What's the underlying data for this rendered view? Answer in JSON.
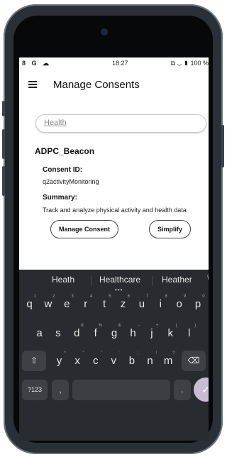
{
  "status": {
    "left_icons": "8 G ☁",
    "time": "18:27",
    "right": "⧉ ◡ ▮ 100 %"
  },
  "appbar": {
    "title": "Manage Consents"
  },
  "search": {
    "value": "Health"
  },
  "consent": {
    "name": "ADPC_Beacon",
    "id_label": "Consent ID:",
    "id_value": "q2activityMonitoring",
    "summary_label": "Summary:",
    "summary_value": "Track and analyze physical activity and health data",
    "manage_label": "Manage Consent",
    "simplify_label": "Simplify"
  },
  "keyboard": {
    "suggestions": [
      "Heath",
      "Healthcare",
      "Heather"
    ],
    "row1": [
      {
        "k": "q",
        "h": "1"
      },
      {
        "k": "w",
        "h": "2"
      },
      {
        "k": "e",
        "h": "3"
      },
      {
        "k": "r",
        "h": "4"
      },
      {
        "k": "t",
        "h": "5"
      },
      {
        "k": "z",
        "h": "6"
      },
      {
        "k": "u",
        "h": "7"
      },
      {
        "k": "i",
        "h": "8"
      },
      {
        "k": "o",
        "h": "9"
      },
      {
        "k": "p",
        "h": "0"
      }
    ],
    "row2": [
      {
        "k": "a",
        "h": ""
      },
      {
        "k": "s",
        "h": ""
      },
      {
        "k": "d",
        "h": "€"
      },
      {
        "k": "f",
        "h": "%"
      },
      {
        "k": "g",
        "h": "&"
      },
      {
        "k": "h",
        "h": "-"
      },
      {
        "k": "j",
        "h": "+"
      },
      {
        "k": "k",
        "h": "("
      },
      {
        "k": "l",
        "h": ")"
      }
    ],
    "row3": [
      {
        "k": "y",
        "h": "*"
      },
      {
        "k": "x",
        "h": "\""
      },
      {
        "k": "c",
        "h": "'"
      },
      {
        "k": "v",
        "h": ":"
      },
      {
        "k": "b",
        "h": ";"
      },
      {
        "k": "n",
        "h": "!"
      },
      {
        "k": "m",
        "h": "?"
      }
    ],
    "shift": "⇧",
    "backspace": "⌫",
    "sym": "?123",
    "comma": ",",
    "period": ".",
    "enter": "✓",
    "mic": "🎙"
  }
}
